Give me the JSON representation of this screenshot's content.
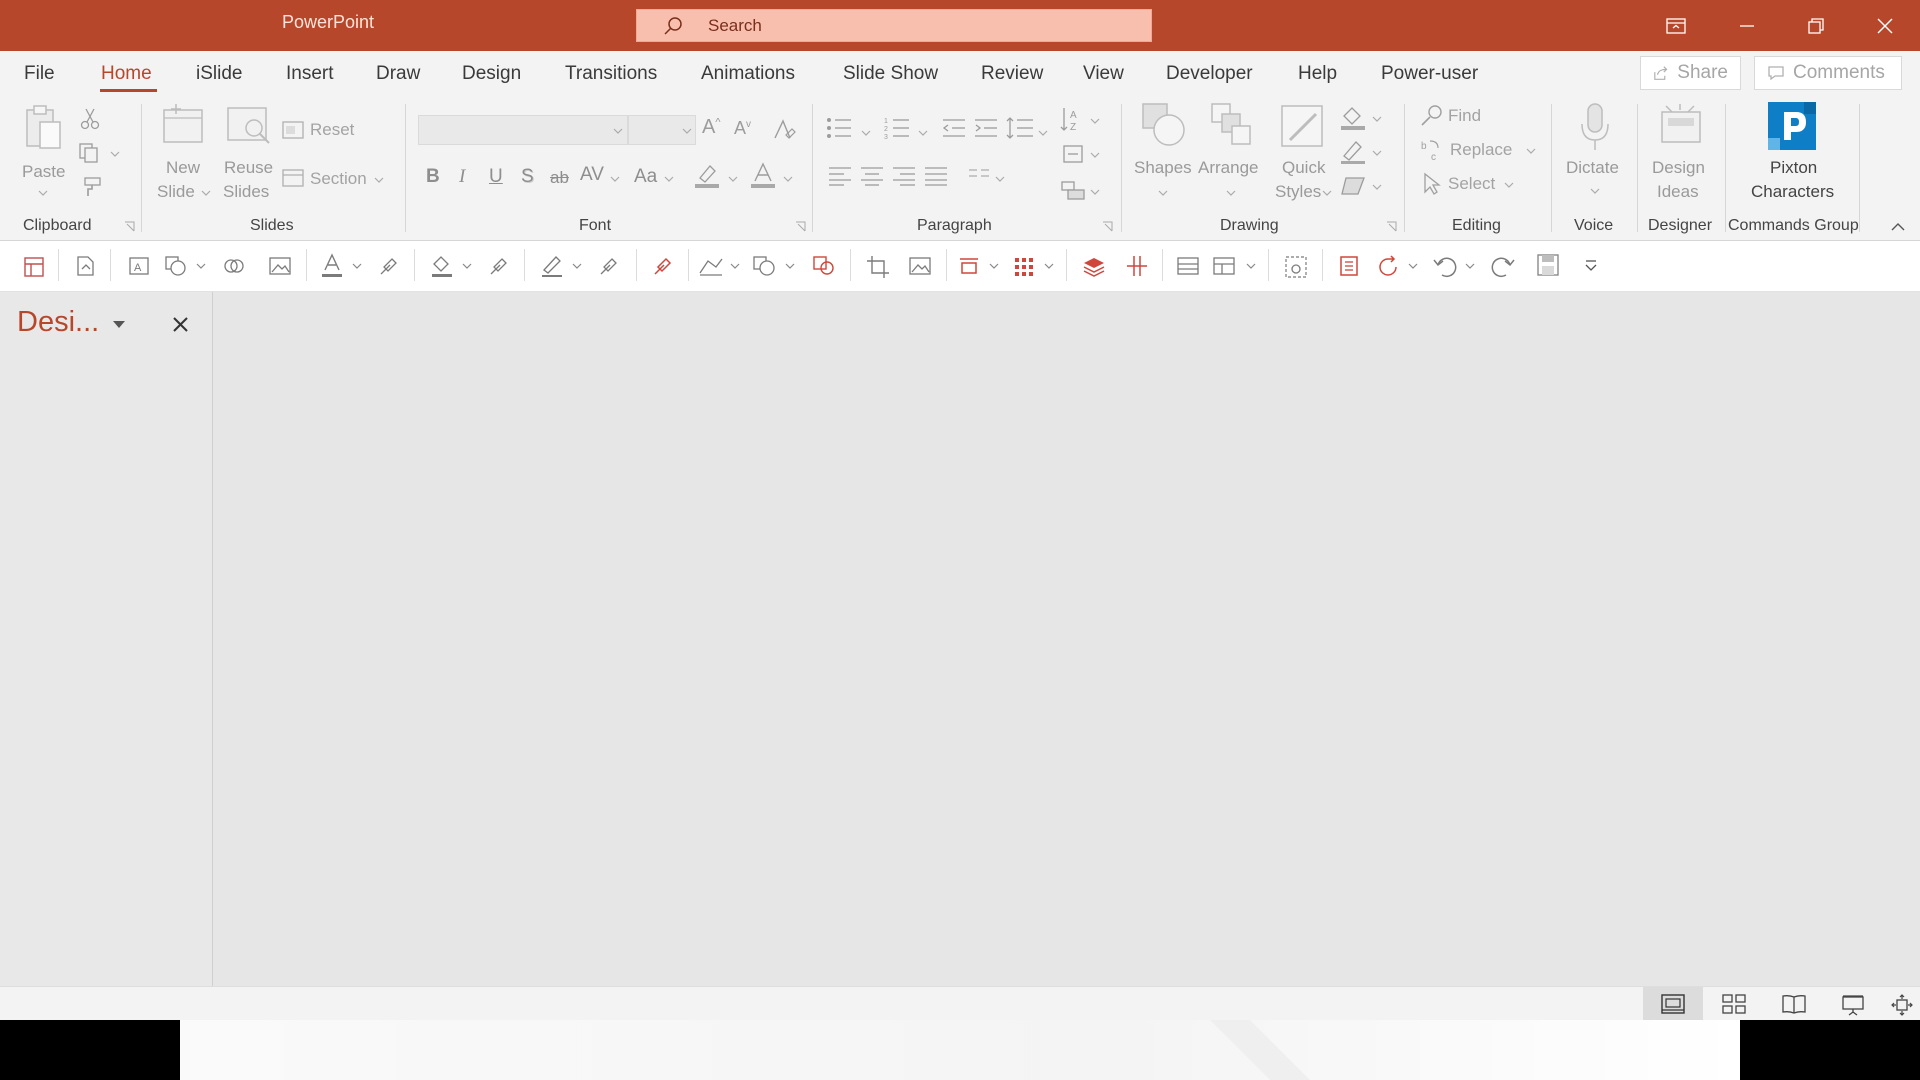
{
  "app": {
    "title": "PowerPoint"
  },
  "search": {
    "placeholder": "Search"
  },
  "tabs": [
    "File",
    "Home",
    "iSlide",
    "Insert",
    "Draw",
    "Design",
    "Transitions",
    "Animations",
    "Slide Show",
    "Review",
    "View",
    "Developer",
    "Help",
    "Power-user"
  ],
  "top_buttons": {
    "share": "Share",
    "comments": "Comments"
  },
  "ribbon": {
    "clipboard": {
      "group": "Clipboard",
      "paste": "Paste"
    },
    "slides": {
      "group": "Slides",
      "new_slide_1": "New",
      "new_slide_2": "Slide",
      "reuse_1": "Reuse",
      "reuse_2": "Slides",
      "reset": "Reset",
      "section": "Section"
    },
    "font": {
      "group": "Font"
    },
    "paragraph": {
      "group": "Paragraph"
    },
    "drawing": {
      "group": "Drawing",
      "shapes": "Shapes",
      "arrange": "Arrange",
      "quick_1": "Quick",
      "quick_2": "Styles"
    },
    "editing": {
      "group": "Editing",
      "find": "Find",
      "replace": "Replace",
      "select": "Select"
    },
    "voice": {
      "group": "Voice",
      "dictate": "Dictate"
    },
    "designer": {
      "group": "Designer",
      "design_1": "Design",
      "design_2": "Ideas"
    },
    "commands": {
      "group": "Commands Group",
      "pixton_1": "Pixton",
      "pixton_2": "Characters"
    }
  },
  "pane": {
    "title": "Desi..."
  },
  "colors": {
    "accent": "#B7472A",
    "search_bg": "#F8BFAE",
    "ribbon_bg": "#F3F3F3",
    "canvas_bg": "#E6E6E6",
    "pixton": "#0E7FC6"
  }
}
